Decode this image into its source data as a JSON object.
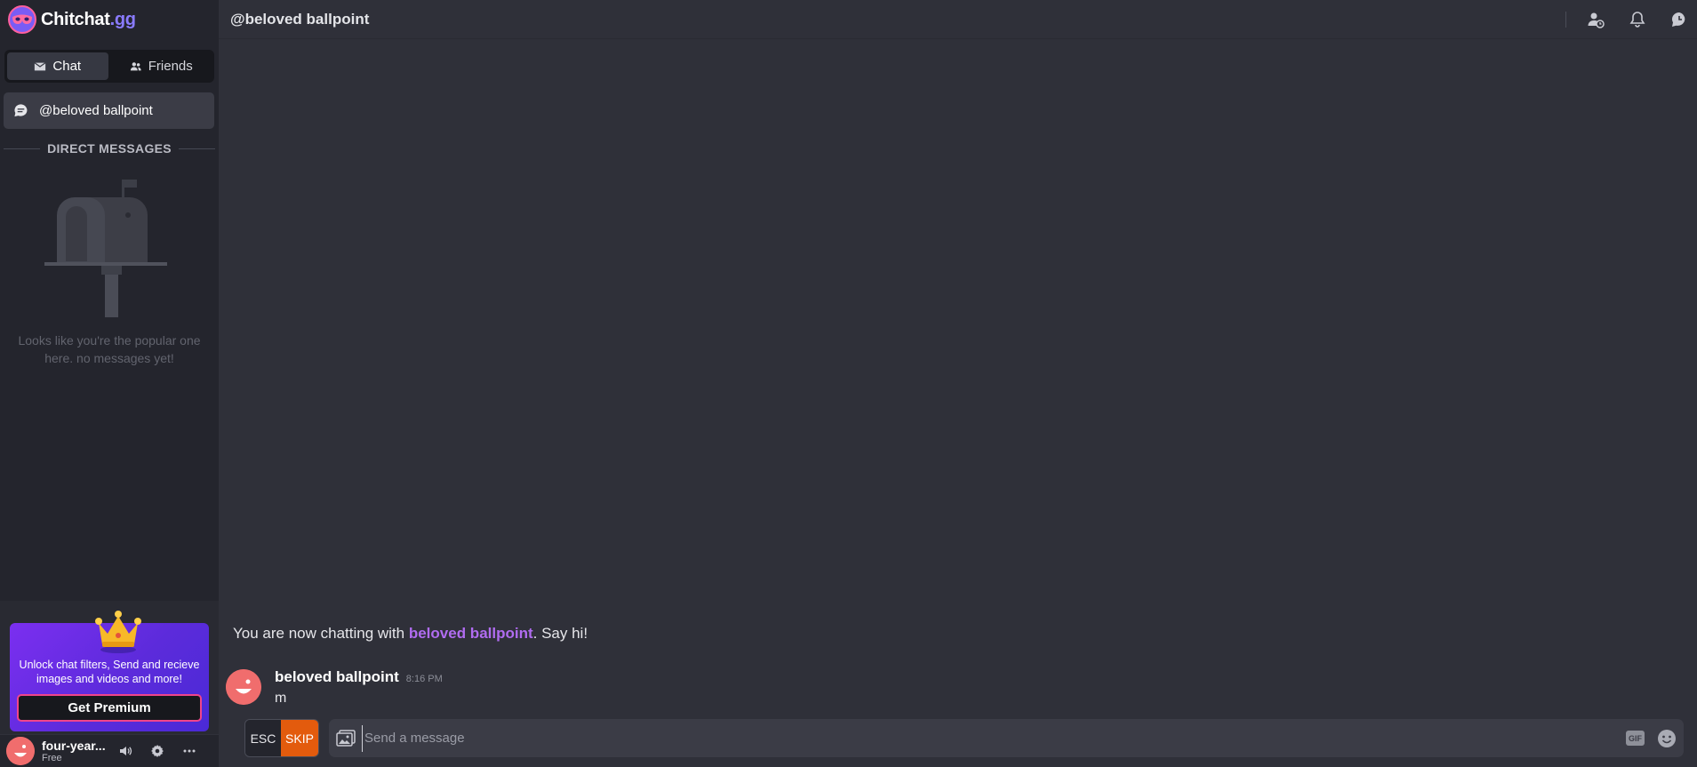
{
  "app": {
    "brand": "Chitchat",
    "brand_tld": ".gg"
  },
  "sidebar": {
    "tabs": [
      {
        "label": "Chat",
        "icon": "mail-icon",
        "active": true
      },
      {
        "label": "Friends",
        "icon": "people-icon",
        "active": false
      }
    ],
    "current_chat": "@beloved ballpoint",
    "section_title": "DIRECT MESSAGES",
    "empty_state": "Looks like you're the popular one here. no messages yet!",
    "premium": {
      "text": "Unlock chat filters, Send and recieve images and videos and more!",
      "button": "Get Premium"
    },
    "user": {
      "name": "four-year...",
      "plan": "Free"
    }
  },
  "header": {
    "title": "@beloved ballpoint"
  },
  "chat": {
    "system_prefix": "You are now chatting with ",
    "system_name": "beloved ballpoint",
    "system_suffix": ". Say hi!",
    "messages": [
      {
        "author": "beloved ballpoint",
        "time": "8:16 PM",
        "text": "m"
      }
    ]
  },
  "composer": {
    "esc_label": "ESC",
    "skip_label": "SKIP",
    "placeholder": "Send a message",
    "gif_label": "GIF"
  },
  "colors": {
    "background": "#2f3039",
    "sidebar": "#24252d",
    "accent_purple": "#b06cf0",
    "skip_orange": "#e35b0d",
    "premium_border": "#f0458b"
  }
}
